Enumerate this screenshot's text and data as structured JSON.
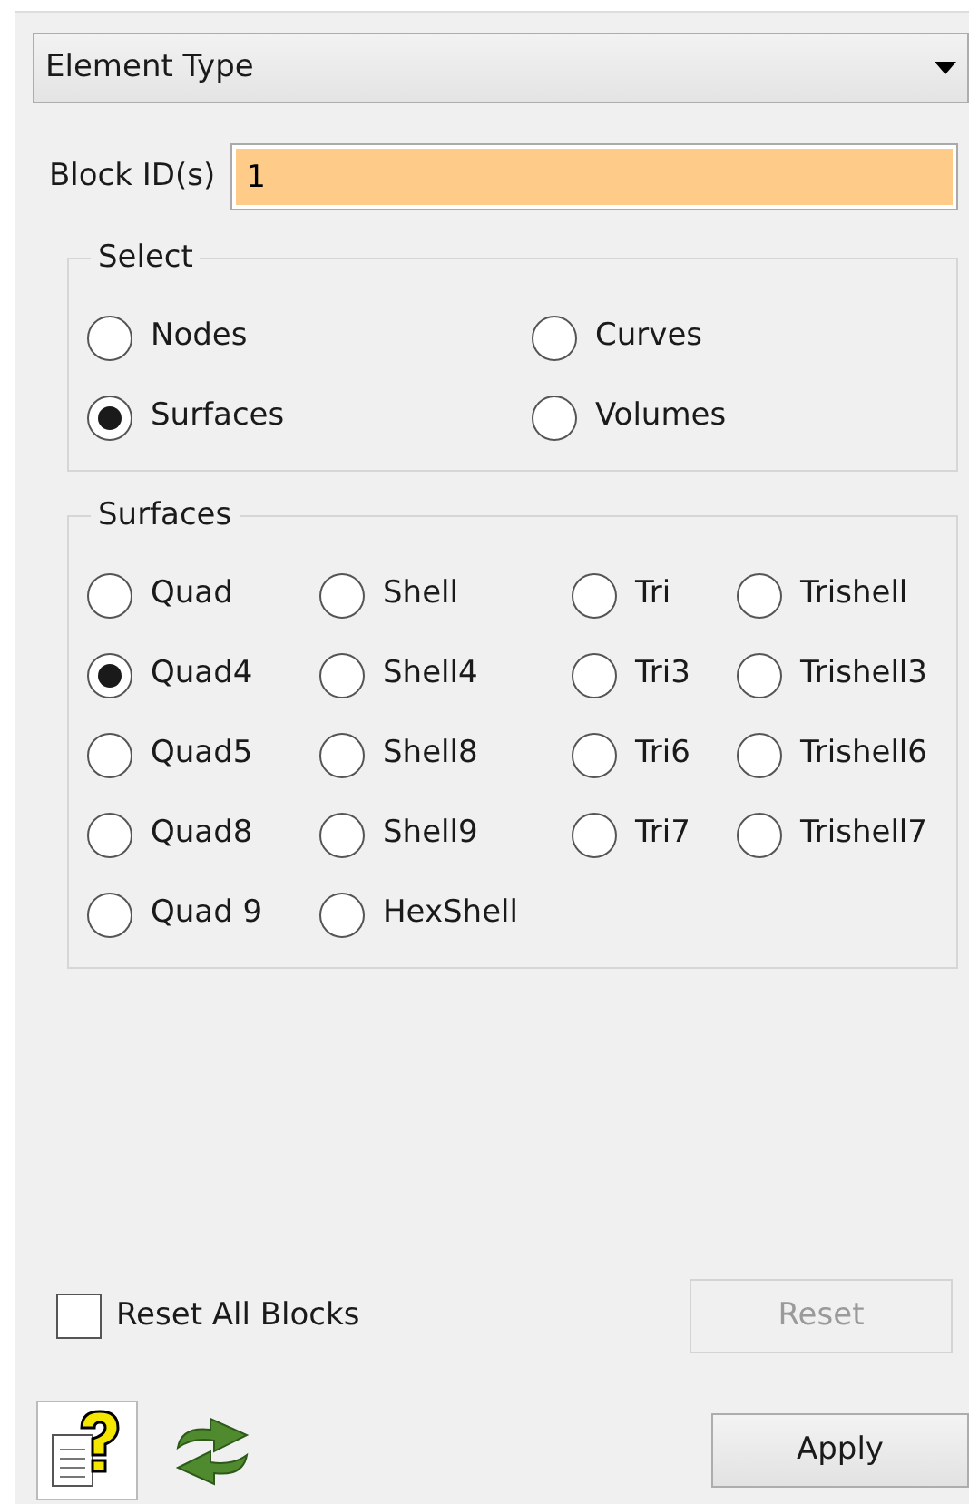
{
  "dropdown": {
    "value": "Element Type"
  },
  "block_ids": {
    "label": "Block ID(s)",
    "value": "1",
    "highlighted": true
  },
  "select_group": {
    "title": "Select",
    "options": [
      {
        "label": "Nodes",
        "selected": false
      },
      {
        "label": "Curves",
        "selected": false
      },
      {
        "label": "Surfaces",
        "selected": true
      },
      {
        "label": "Volumes",
        "selected": false
      }
    ]
  },
  "surfaces_group": {
    "title": "Surfaces",
    "options": [
      {
        "label": "Quad",
        "selected": false
      },
      {
        "label": "Shell",
        "selected": false
      },
      {
        "label": "Tri",
        "selected": false
      },
      {
        "label": "Trishell",
        "selected": false
      },
      {
        "label": "Quad4",
        "selected": true
      },
      {
        "label": "Shell4",
        "selected": false
      },
      {
        "label": "Tri3",
        "selected": false
      },
      {
        "label": "Trishell3",
        "selected": false
      },
      {
        "label": "Quad5",
        "selected": false
      },
      {
        "label": "Shell8",
        "selected": false
      },
      {
        "label": "Tri6",
        "selected": false
      },
      {
        "label": "Trishell6",
        "selected": false
      },
      {
        "label": "Quad8",
        "selected": false
      },
      {
        "label": "Shell9",
        "selected": false
      },
      {
        "label": "Tri7",
        "selected": false
      },
      {
        "label": "Trishell7",
        "selected": false
      },
      {
        "label": "Quad 9",
        "selected": false
      },
      {
        "label": "HexShell",
        "selected": false
      }
    ]
  },
  "reset_all": {
    "label": "Reset All Blocks",
    "checked": false
  },
  "reset_button": {
    "label": "Reset",
    "disabled": true
  },
  "apply_button": {
    "label": "Apply",
    "disabled": false
  }
}
